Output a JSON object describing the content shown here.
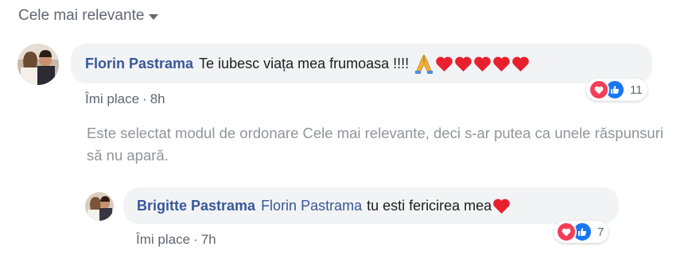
{
  "sort": {
    "label": "Cele mai relevante"
  },
  "comment": {
    "author": "Florin Pastrama",
    "text": "Te iubesc viața mea frumoasa !!!!",
    "emoji": [
      "folded-hands",
      "heart",
      "heart",
      "heart",
      "heart",
      "heart"
    ],
    "like_label": "Îmi place",
    "time": "8h",
    "reaction_count": "11"
  },
  "notice": "Este selectat modul de ordonare Cele mai relevante, deci s-ar putea ca unele răspunsuri să nu apară.",
  "reply": {
    "author": "Brigitte Pastrama",
    "mention": "Florin Pastrama",
    "text": "tu esti fericirea mea",
    "emoji": [
      "heart"
    ],
    "like_label": "Îmi place",
    "time": "7h",
    "reaction_count": "7"
  },
  "colors": {
    "link": "#385898",
    "secondary_text": "#606770",
    "bubble": "#f2f3f5",
    "love": "#f33e58",
    "like": "#1877f2",
    "heart": "#e8202e"
  }
}
